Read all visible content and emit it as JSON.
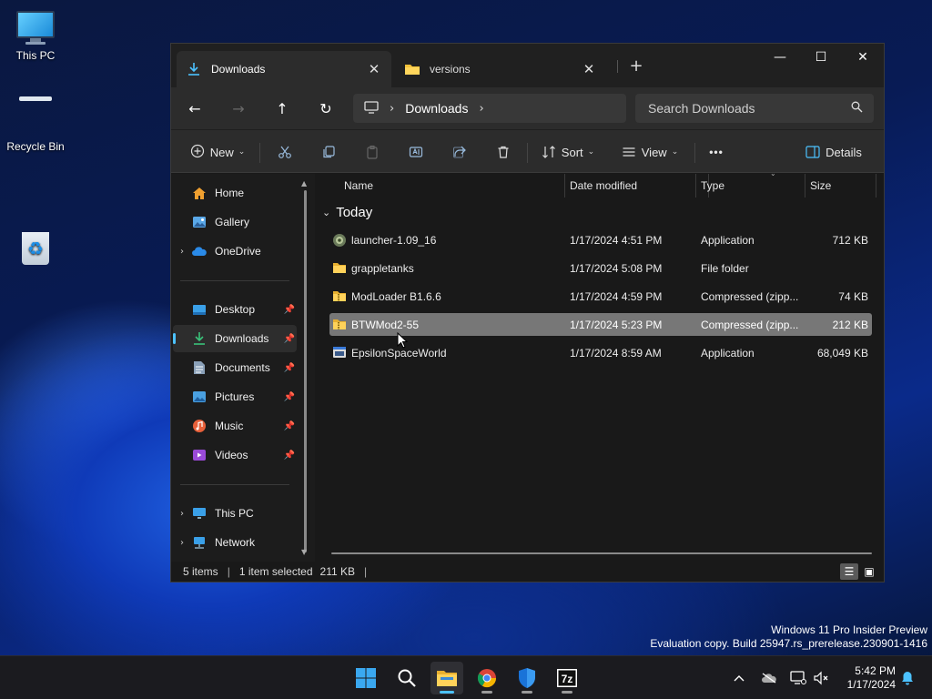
{
  "desktop": {
    "icons": [
      {
        "label": "This PC",
        "icon": "computer-icon"
      },
      {
        "label": "Recycle Bin",
        "icon": "recycle-bin-icon"
      }
    ]
  },
  "window": {
    "tabs": [
      {
        "label": "Downloads",
        "icon": "download-icon",
        "active": true
      },
      {
        "label": "versions",
        "icon": "folder-icon",
        "active": false
      }
    ],
    "controls": {
      "minimize": "—",
      "maximize": "☐",
      "close": "✕"
    }
  },
  "nav": {
    "back": "←",
    "forward": "→",
    "up": "↑",
    "refresh": "↻",
    "breadcrumb": [
      "Downloads"
    ],
    "search_placeholder": "Search Downloads"
  },
  "toolbar": {
    "new_label": "New",
    "sort_label": "Sort",
    "view_label": "View",
    "more_label": "•••",
    "details_label": "Details"
  },
  "sidebar": {
    "top": [
      {
        "label": "Home",
        "icon": "home-icon"
      },
      {
        "label": "Gallery",
        "icon": "gallery-icon"
      },
      {
        "label": "OneDrive",
        "icon": "onedrive-icon",
        "expandable": true
      }
    ],
    "quick": [
      {
        "label": "Desktop",
        "icon": "desktop-icon",
        "pinned": true
      },
      {
        "label": "Downloads",
        "icon": "download-icon",
        "pinned": true,
        "selected": true
      },
      {
        "label": "Documents",
        "icon": "documents-icon",
        "pinned": true
      },
      {
        "label": "Pictures",
        "icon": "pictures-icon",
        "pinned": true
      },
      {
        "label": "Music",
        "icon": "music-icon",
        "pinned": true
      },
      {
        "label": "Videos",
        "icon": "videos-icon",
        "pinned": true
      }
    ],
    "bottom": [
      {
        "label": "This PC",
        "icon": "computer-icon",
        "expandable": true
      },
      {
        "label": "Network",
        "icon": "network-icon",
        "expandable": true
      }
    ]
  },
  "columns": {
    "name": "Name",
    "date": "Date modified",
    "type": "Type",
    "size": "Size"
  },
  "group_label": "Today",
  "files": [
    {
      "name": "launcher-1.09_16",
      "date": "1/17/2024 4:51 PM",
      "type": "Application",
      "size": "712 KB",
      "icon": "app-icon"
    },
    {
      "name": "grappletanks",
      "date": "1/17/2024 5:08 PM",
      "type": "File folder",
      "size": "",
      "icon": "folder-icon"
    },
    {
      "name": "ModLoader B1.6.6",
      "date": "1/17/2024 4:59 PM",
      "type": "Compressed (zipp...",
      "size": "74 KB",
      "icon": "zip-folder-icon"
    },
    {
      "name": "BTWMod2-55",
      "date": "1/17/2024 5:23 PM",
      "type": "Compressed (zipp...",
      "size": "212 KB",
      "icon": "zip-folder-icon",
      "selected": true
    },
    {
      "name": "EpsilonSpaceWorld",
      "date": "1/17/2024 8:59 AM",
      "type": "Application",
      "size": "68,049 KB",
      "icon": "app-window-icon"
    }
  ],
  "status": {
    "items": "5 items",
    "selection": "1 item selected",
    "size": "211 KB"
  },
  "watermark": {
    "line1": "Windows 11 Pro Insider Preview",
    "line2": "Evaluation copy. Build 25947.rs_prerelease.230901-1416"
  },
  "taskbar": {
    "apps": [
      "start-icon",
      "search-icon",
      "file-explorer-icon",
      "chrome-icon",
      "defender-icon",
      "7zip-icon"
    ],
    "time": "5:42 PM",
    "date": "1/17/2024"
  },
  "colors": {
    "accent": "#4cc2ff",
    "selection": "#777777",
    "window_bg": "#191919"
  }
}
